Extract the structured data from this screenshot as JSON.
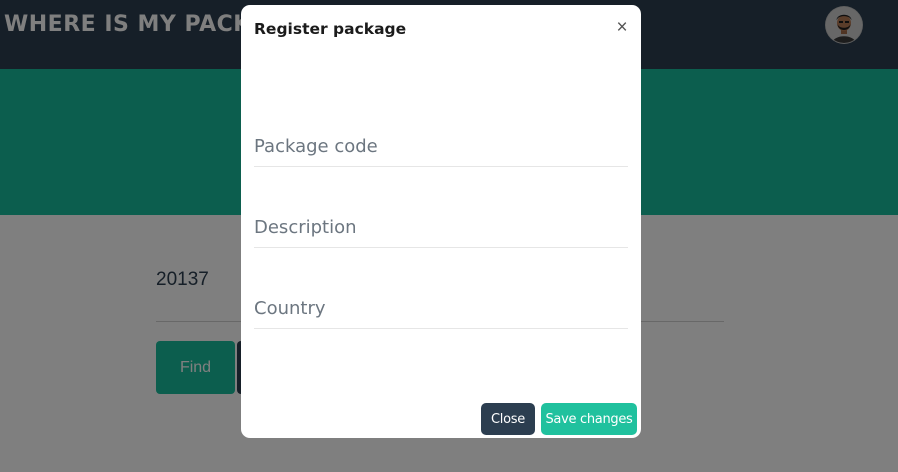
{
  "navbar": {
    "brand": "WHERE IS MY PACKAGE?",
    "avatar_icon": "user-avatar-icon"
  },
  "search": {
    "value": "20137",
    "find_label": "Find"
  },
  "modal": {
    "title": "Register package",
    "close_glyph": "×",
    "fields": {
      "package_code_placeholder": "Package code",
      "description_placeholder": "Description",
      "country_placeholder": "Country"
    },
    "close_label": "Close",
    "save_label": "Save changes"
  },
  "colors": {
    "navbar": "#2c3e50",
    "primary": "#18bc9c",
    "dark_button": "#2c3e50"
  }
}
